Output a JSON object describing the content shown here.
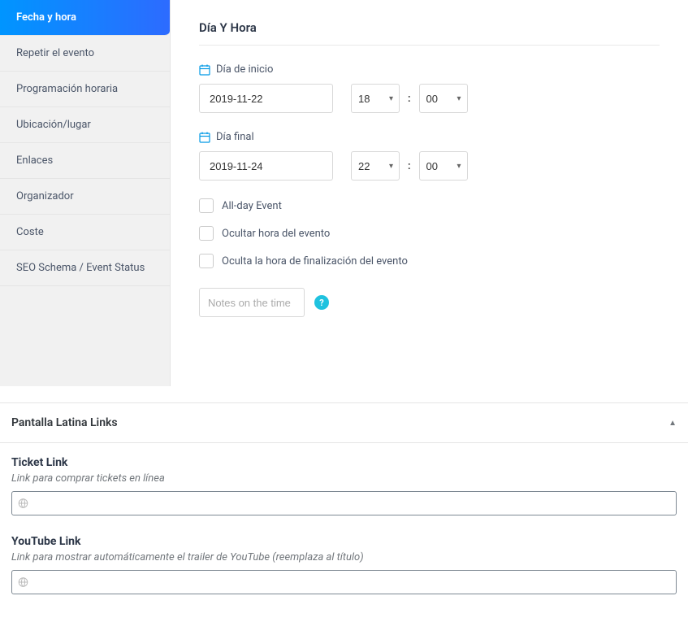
{
  "sidebar": {
    "items": [
      {
        "label": "Fecha y hora",
        "active": true
      },
      {
        "label": "Repetir el evento",
        "active": false
      },
      {
        "label": "Programación horaria",
        "active": false
      },
      {
        "label": "Ubicación/lugar",
        "active": false
      },
      {
        "label": "Enlaces",
        "active": false
      },
      {
        "label": "Organizador",
        "active": false
      },
      {
        "label": "Coste",
        "active": false
      },
      {
        "label": "SEO Schema / Event Status",
        "active": false
      }
    ]
  },
  "content": {
    "title": "Día Y Hora",
    "start_label": "Día de inicio",
    "start_date": "2019-11-22",
    "start_hour": "18",
    "start_minute": "00",
    "end_label": "Día final",
    "end_date": "2019-11-24",
    "end_hour": "22",
    "end_minute": "00",
    "checkboxes": [
      {
        "label": "All-day Event"
      },
      {
        "label": "Ocultar hora del evento"
      },
      {
        "label": "Oculta la hora de finalización del evento"
      }
    ],
    "notes_placeholder": "Notes on the time"
  },
  "links_panel": {
    "title": "Pantalla Latina Links",
    "blocks": [
      {
        "title": "Ticket Link",
        "desc": "Link para comprar tickets en línea"
      },
      {
        "title": "YouTube Link",
        "desc": "Link para mostrar automáticamente el trailer de YouTube (reemplaza al título)"
      }
    ]
  }
}
